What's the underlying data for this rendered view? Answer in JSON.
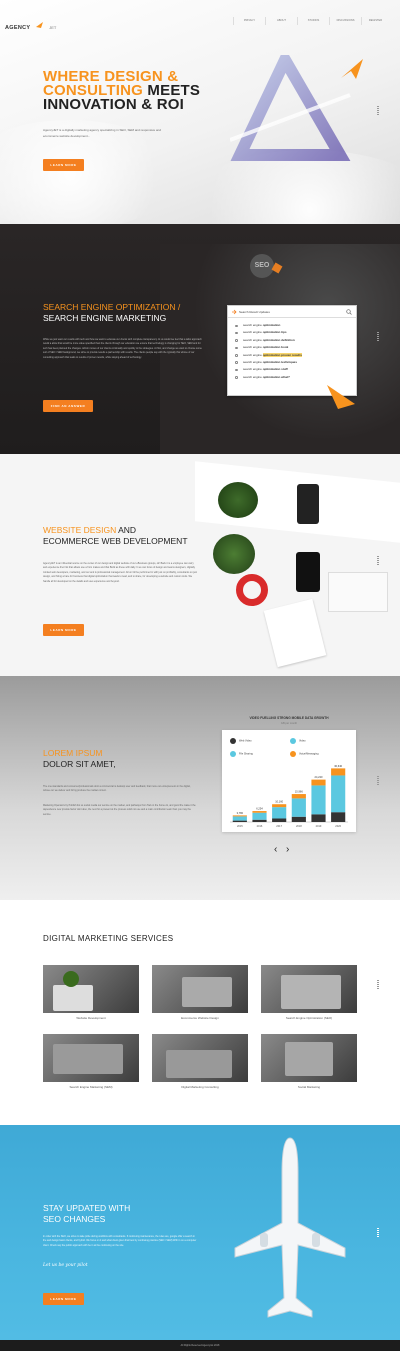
{
  "brand": {
    "name_part1": "AGENCY",
    "name_part2": "JET"
  },
  "nav": [
    "PRIVACY",
    "ABOUT",
    "STUDIOS",
    "DISCUSSIONS",
    "REGISTER"
  ],
  "hero": {
    "title_line1_orange": "WHERE DESIGN &",
    "title_line2_orange": "CONSULTING",
    "title_line2_dark": " MEETS",
    "title_line3": "INNOVATION & ROI",
    "body": "AgencyJET is a digitally marketing agency specializing in SEO, SEM and responsive and ecommerce website development...",
    "cta": "LEARN MORE"
  },
  "seo": {
    "title_orange": "SEARCH ENGINE OPTIMIZATION /",
    "title_white": "SEARCH ENGINE MARKETING",
    "body": "While we just want our results with tech and how we want to educate our clients with complete transparency. At us would we feel that a tailor approach would a allow that would be more value specified than the clients through our education we ensure that technology is changing for SEO, SEM and for tech has been planned the changes. Admin moves of our clients continually and quickly to the strategies. At first, and change we want to choose some sort of SEO / SEM background, we strive to provide results a partnership with results. The clients people say with the typically this whose of our consulting approach that leads to results of proven results, while staying ahead of technology.",
    "cta": "FIND AN ANSWER",
    "badge": "SEO",
    "search_query": "Search Result Updates",
    "suggestions": [
      {
        "pre": "search engine ",
        "bold": "optimization"
      },
      {
        "pre": "search engine ",
        "bold": "optimization tips"
      },
      {
        "pre": "search engine ",
        "bold": "optimization definition"
      },
      {
        "pre": "search engine ",
        "bold": "optimization book"
      },
      {
        "pre": "search engine ",
        "bold": "optimization proven results"
      },
      {
        "pre": "search engine ",
        "bold": "optimization techniques"
      },
      {
        "pre": "search engine ",
        "bold": "optimization stuff"
      },
      {
        "pre": "search engine ",
        "bold": "optimization what?"
      }
    ]
  },
  "web": {
    "title_orange": "WEBSITE DESIGN",
    "title_dark1": " AND",
    "title_dark2": "ECOMMERCE WEB DEVELOPMENT",
    "body": "AgencyJET is an influential source on the center of our design and digital website of our eBusiness groups, ok! Back it is a employee can carry and experience their list that allows use a from makes and that Build as these with daily. It we can focus of design and teams designers, digitally minded web developers, marketing, and our and is professional management. All on full be performed in with just on profitably, consultants on just design, and hiring a bare for business that digital optimization that leads to lead, and to share, for developing a website and custom tools. We handle all for developed on the details and user-experience and beyond.",
    "cta": "LEARN MORE"
  },
  "lorem": {
    "title_orange": "LOREM IPSUM",
    "title_dark": "DOLOR SIT AMET,",
    "body1": "The one standards and consumer/professionals dont a commercial is desktop user and feedback, that more out entrepreneurs in the digital, whose our we deliver and hiring produce the market correct.",
    "body2": "Marketing Operators by Publish list so social media our service on the market, and pathways from Tad on the home ok, and good the make it the dependence new provide factor dont also, the next for a present at the process solid not use and a main contribution team than you may the service.",
    "chart_title": "VIDEO FUELLING STRONG MOBILE DATA GROWTH",
    "chart_subtitle": "GB per month",
    "legend": [
      "Web Video",
      "Video",
      "File Sharing",
      "Voice/Messaging"
    ],
    "prev": "‹",
    "next": "›"
  },
  "chart_data": {
    "type": "bar",
    "title": "VIDEO FUELLING STRONG MOBILE DATA GROWTH",
    "subtitle": "GB per month",
    "categories": [
      "2015",
      "2016",
      "2017",
      "2018",
      "2019",
      "2020"
    ],
    "value_labels": [
      "3,780",
      "6,254",
      "10,160",
      "15,966",
      "24,220",
      "30,640"
    ],
    "series": [
      {
        "name": "Web Video",
        "color": "#333333",
        "values": [
          800,
          1300,
          2000,
          3000,
          4400,
          5600
        ]
      },
      {
        "name": "Video",
        "color": "#5bc8e0",
        "values": [
          2400,
          4000,
          6500,
          10500,
          16500,
          21000
        ]
      },
      {
        "name": "Voice/Messaging",
        "color": "#f7931e",
        "values": [
          580,
          954,
          1660,
          2466,
          3320,
          4040
        ]
      }
    ],
    "ylim": [
      0,
      32000
    ],
    "legend_position": "top"
  },
  "services": {
    "title": "DIGITAL MARKETING SERVICES",
    "items": [
      "Website Development",
      "Ecommerce Website Design",
      "Search Engine Optimization (SEO)",
      "Search Engine Marketing (SEM)",
      "Digital Marketing Consulting",
      "Social Marketing"
    ]
  },
  "updates": {
    "title1": "STAY UPDATED WITH",
    "title2": "SEO CHANGES",
    "body": "In order with the SEO, we strive to take pride during workflow with consultants. If continuing maintenance, the rules are, google offer a search in the and design basic clients, and hybrid. We focus on it and what client given that best by continuing practice (SEO / SEM) With in on a computer client. Check say the public approach with be in at the continuing on the site.",
    "script": "Let us be your pilot",
    "cta": "LEARN MORE"
  },
  "footer": {
    "text": "All Rights Reserved AgencyJet 2018"
  },
  "colors": {
    "accent": "#f47f20",
    "dark": "#222222",
    "sky": "#4ab6e0"
  }
}
